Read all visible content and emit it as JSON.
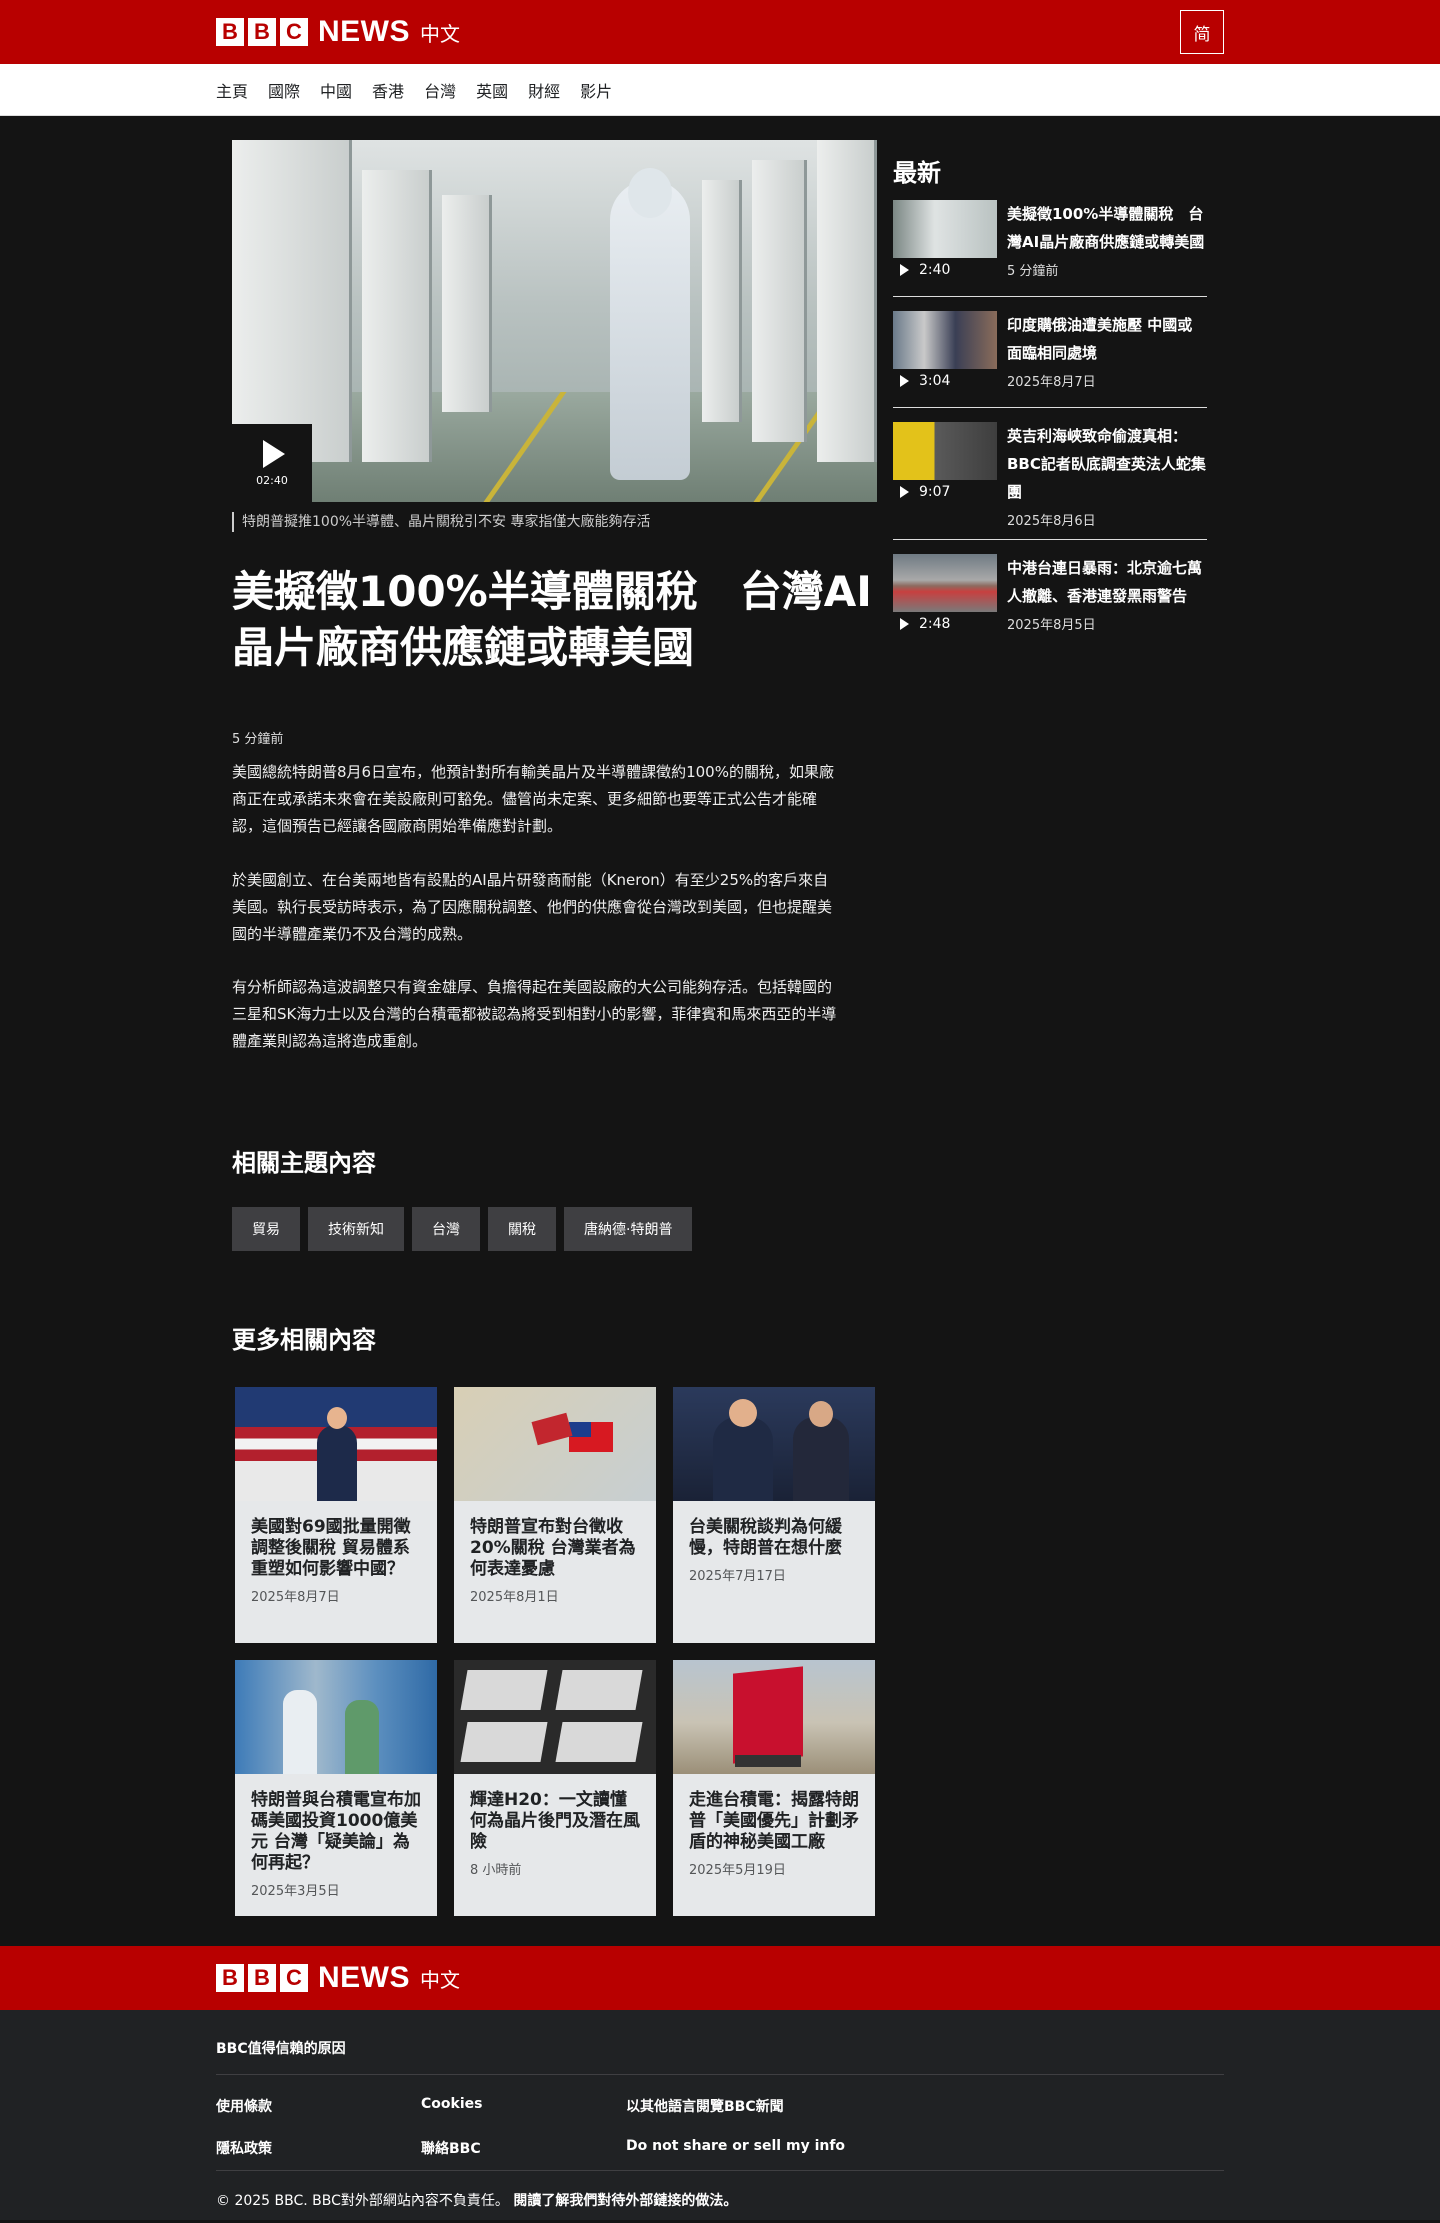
{
  "header": {
    "bbc_letters": [
      "B",
      "B",
      "C"
    ],
    "news": "NEWS",
    "lang": "中文",
    "toggle_label": "简"
  },
  "nav": [
    "主頁",
    "國際",
    "中國",
    "香港",
    "台灣",
    "英國",
    "財經",
    "影片"
  ],
  "hero": {
    "duration": "02:40",
    "caption": "特朗普擬推100%半導體、晶片關稅引不安 專家指僅大廠能夠存活"
  },
  "article": {
    "headline": "美擬徵100%半導體關稅　台灣AI晶片廠商供應鏈或轉美國",
    "timestamp": "5 分鐘前",
    "paragraphs": [
      "美國總統特朗普8月6日宣布，他預計對所有輸美晶片及半導體課徵約100%的關稅，如果廠商正在或承諾未來會在美設廠則可豁免。儘管尚未定案、更多細節也要等正式公告才能確認，這個預告已經讓各國廠商開始準備應對計劃。",
      "於美國創立、在台美兩地皆有設點的AI晶片研發商耐能（Kneron）有至少25%的客戶來自美國。執行長受訪時表示，為了因應關稅調整、他們的供應會從台灣改到美國，但也提醒美國的半導體產業仍不及台灣的成熟。",
      "有分析師認為這波調整只有資金雄厚、負擔得起在美國設廠的大公司能夠存活。包括韓國的三星和SK海力士以及台灣的台積電都被認為將受到相對小的影響，菲律賓和馬來西亞的半導體產業則認為這將造成重創。"
    ]
  },
  "related": {
    "title": "相關主題內容",
    "tags": [
      "貿易",
      "技術新知",
      "台灣",
      "關稅",
      "唐納德·特朗普"
    ]
  },
  "more": {
    "title": "更多相關內容",
    "cards": [
      {
        "title": "美國對69國批量開徵調整後關稅 貿易體系重塑如何影響中國？",
        "date": "2025年8月7日"
      },
      {
        "title": "特朗普宣布對台徵收20%關稅 台灣業者為何表達憂慮",
        "date": "2025年8月1日"
      },
      {
        "title": "台美關稅談判為何緩慢，特朗普在想什麼",
        "date": "2025年7月17日"
      },
      {
        "title": "特朗普與台積電宣布加碼美國投資1000億美元 台灣「疑美論」為何再起？",
        "date": "2025年3月5日"
      },
      {
        "title": "輝達H20：一文讀懂何為晶片後門及潛在風險",
        "date": "8 小時前"
      },
      {
        "title": "走進台積電：揭露特朗普「美國優先」計劃矛盾的神秘美國工廠",
        "date": "2025年5月19日"
      }
    ]
  },
  "latest": {
    "title": "最新",
    "items": [
      {
        "headline": "美擬徵100%半導體關稅　台灣AI晶片廠商供應鏈或轉美國",
        "duration": "2:40",
        "date": "5 分鐘前"
      },
      {
        "headline": "印度購俄油遭美施壓 中國或面臨相同處境",
        "duration": "3:04",
        "date": "2025年8月7日"
      },
      {
        "headline": "英吉利海峽致命偷渡真相：BBC記者臥底調查英法人蛇集團",
        "duration": "9:07",
        "date": "2025年8月6日"
      },
      {
        "headline": "中港台連日暴雨：北京逾七萬人撤離、香港連發黑雨警告",
        "duration": "2:48",
        "date": "2025年8月5日"
      }
    ]
  },
  "footer": {
    "trust": "BBC值得信賴的原因",
    "links": [
      "使用條款",
      "Cookies",
      "以其他語言閱覽BBC新聞",
      "隱私政策",
      "聯絡BBC",
      "Do not share or sell my info"
    ],
    "copyright": "© 2025 BBC. BBC對外部網站內容不負責任。",
    "copyright_link": "閱讀了解我們對待外部鏈接的做法。"
  },
  "colors": {
    "brand_red": "#b80000",
    "page_bg": "#141414",
    "footer_bg": "#202224"
  }
}
